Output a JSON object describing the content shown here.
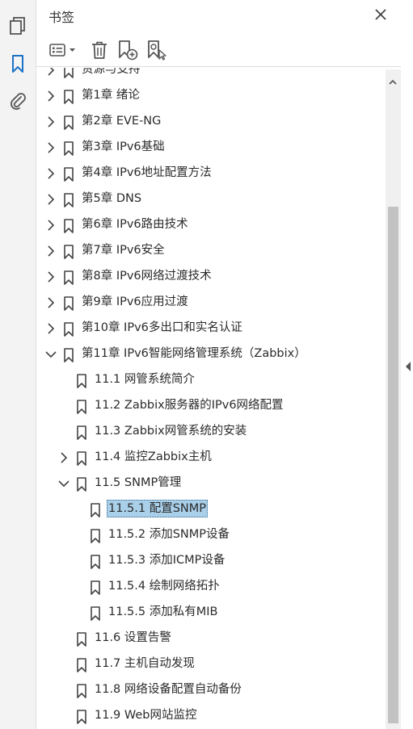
{
  "panel": {
    "title": "书签"
  },
  "rail": {
    "items": [
      {
        "icon": "pages-icon"
      },
      {
        "icon": "bookmark-icon",
        "active": true
      },
      {
        "icon": "attachment-icon"
      }
    ]
  },
  "toolbar": {
    "options_icon": "options-list-icon",
    "delete_icon": "trash-icon",
    "new_bookmark_icon": "new-bookmark-icon",
    "find_bookmark_icon": "find-bookmark-icon"
  },
  "colors": {
    "selected_bg": "#a9cfe9",
    "accent": "#1a73c8"
  },
  "tree": [
    {
      "label": "资源与支持",
      "level": 0,
      "expander": "collapsed",
      "partial": true
    },
    {
      "label": "第1章 绪论",
      "level": 0,
      "expander": "collapsed"
    },
    {
      "label": "第2章 EVE-NG",
      "level": 0,
      "expander": "collapsed"
    },
    {
      "label": "第3章 IPv6基础",
      "level": 0,
      "expander": "collapsed"
    },
    {
      "label": "第4章 IPv6地址配置方法",
      "level": 0,
      "expander": "collapsed"
    },
    {
      "label": "第5章 DNS",
      "level": 0,
      "expander": "collapsed"
    },
    {
      "label": "第6章 IPv6路由技术",
      "level": 0,
      "expander": "collapsed"
    },
    {
      "label": "第7章 IPv6安全",
      "level": 0,
      "expander": "collapsed"
    },
    {
      "label": "第8章 IPv6网络过渡技术",
      "level": 0,
      "expander": "collapsed"
    },
    {
      "label": "第9章 IPv6应用过渡",
      "level": 0,
      "expander": "collapsed"
    },
    {
      "label": "第10章 IPv6多出口和实名认证",
      "level": 0,
      "expander": "collapsed"
    },
    {
      "label": "第11章 IPv6智能网络管理系统（Zabbix）",
      "level": 0,
      "expander": "expanded"
    },
    {
      "label": "11.1 网管系统简介",
      "level": 1,
      "expander": "none"
    },
    {
      "label": "11.2 Zabbix服务器的IPv6网络配置",
      "level": 1,
      "expander": "none"
    },
    {
      "label": "11.3 Zabbix网管系统的安装",
      "level": 1,
      "expander": "none"
    },
    {
      "label": "11.4 监控Zabbix主机",
      "level": 1,
      "expander": "collapsed"
    },
    {
      "label": "11.5 SNMP管理",
      "level": 1,
      "expander": "expanded"
    },
    {
      "label": "11.5.1 配置SNMP",
      "level": 2,
      "expander": "none",
      "selected": true
    },
    {
      "label": "11.5.2 添加SNMP设备",
      "level": 2,
      "expander": "none"
    },
    {
      "label": "11.5.3 添加ICMP设备",
      "level": 2,
      "expander": "none"
    },
    {
      "label": "11.5.4 绘制网络拓扑",
      "level": 2,
      "expander": "none"
    },
    {
      "label": "11.5.5 添加私有MIB",
      "level": 2,
      "expander": "none"
    },
    {
      "label": "11.6 设置告警",
      "level": 1,
      "expander": "none"
    },
    {
      "label": "11.7 主机自动发现",
      "level": 1,
      "expander": "none"
    },
    {
      "label": "11.8 网络设备配置自动备份",
      "level": 1,
      "expander": "none"
    },
    {
      "label": "11.9 Web网站监控",
      "level": 1,
      "expander": "none"
    }
  ]
}
